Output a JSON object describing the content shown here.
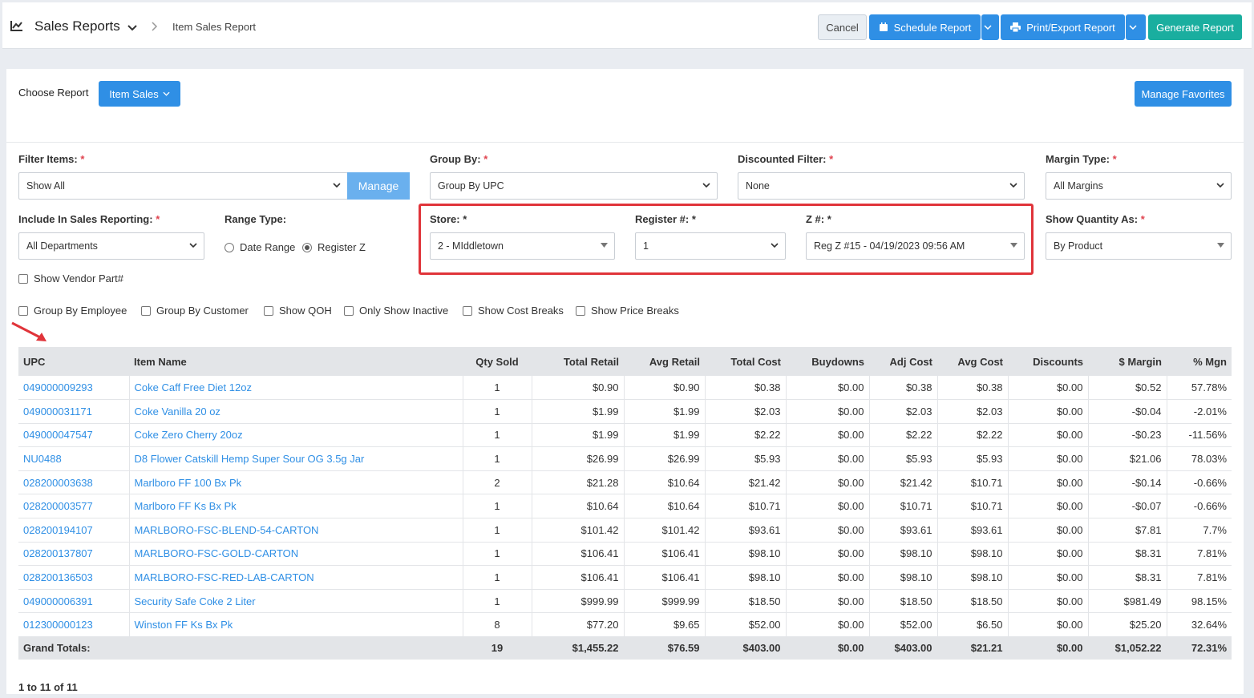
{
  "header": {
    "app_title": "Sales Reports",
    "breadcrumb": "Item Sales Report",
    "cancel": "Cancel",
    "schedule": "Schedule Report",
    "print_export": "Print/Export Report",
    "generate": "Generate Report"
  },
  "report": {
    "choose_label": "Choose Report",
    "selected": "Item Sales",
    "manage_favorites": "Manage Favorites"
  },
  "filters": {
    "filter_items": {
      "label": "Filter Items:",
      "value": "Show All",
      "manage": "Manage"
    },
    "group_by": {
      "label": "Group By:",
      "value": "Group By UPC"
    },
    "discounted": {
      "label": "Discounted Filter:",
      "value": "None"
    },
    "margin_type": {
      "label": "Margin Type:",
      "value": "All Margins"
    },
    "include": {
      "label": "Include In Sales Reporting:",
      "value": "All Departments"
    },
    "range_type": {
      "label": "Range Type:",
      "option_date": "Date Range",
      "option_register": "Register Z",
      "selected": "Register Z"
    },
    "store": {
      "label": "Store:",
      "value": "2 - MIddletown"
    },
    "register": {
      "label": "Register #:",
      "value": "1"
    },
    "z": {
      "label": "Z #:",
      "value": "Reg Z #15 - 04/19/2023 09:56 AM"
    },
    "show_qty": {
      "label": "Show Quantity As:",
      "value": "By Product"
    },
    "required_mark": "*",
    "show_vendor_part": "Show Vendor Part#",
    "checks": [
      "Group By Employee",
      "Group By Customer",
      "Show QOH",
      "Only Show Inactive",
      "Show Cost Breaks",
      "Show Price Breaks"
    ]
  },
  "table": {
    "columns": [
      "UPC",
      "Item Name",
      "Qty Sold",
      "Total Retail",
      "Avg Retail",
      "Total Cost",
      "Buydowns",
      "Adj Cost",
      "Avg Cost",
      "Discounts",
      "$ Margin",
      "% Mgn"
    ],
    "rows": [
      [
        "049000009293",
        "Coke Caff Free Diet 12oz",
        "1",
        "$0.90",
        "$0.90",
        "$0.38",
        "$0.00",
        "$0.38",
        "$0.38",
        "$0.00",
        "$0.52",
        "57.78%"
      ],
      [
        "049000031171",
        "Coke Vanilla 20 oz",
        "1",
        "$1.99",
        "$1.99",
        "$2.03",
        "$0.00",
        "$2.03",
        "$2.03",
        "$0.00",
        "-$0.04",
        "-2.01%"
      ],
      [
        "049000047547",
        "Coke Zero Cherry 20oz",
        "1",
        "$1.99",
        "$1.99",
        "$2.22",
        "$0.00",
        "$2.22",
        "$2.22",
        "$0.00",
        "-$0.23",
        "-11.56%"
      ],
      [
        "NU0488",
        "D8 Flower Catskill Hemp Super Sour OG 3.5g Jar",
        "1",
        "$26.99",
        "$26.99",
        "$5.93",
        "$0.00",
        "$5.93",
        "$5.93",
        "$0.00",
        "$21.06",
        "78.03%"
      ],
      [
        "028200003638",
        "Marlboro FF 100 Bx Pk",
        "2",
        "$21.28",
        "$10.64",
        "$21.42",
        "$0.00",
        "$21.42",
        "$10.71",
        "$0.00",
        "-$0.14",
        "-0.66%"
      ],
      [
        "028200003577",
        "Marlboro FF Ks Bx Pk",
        "1",
        "$10.64",
        "$10.64",
        "$10.71",
        "$0.00",
        "$10.71",
        "$10.71",
        "$0.00",
        "-$0.07",
        "-0.66%"
      ],
      [
        "028200194107",
        "MARLBORO-FSC-BLEND-54-CARTON",
        "1",
        "$101.42",
        "$101.42",
        "$93.61",
        "$0.00",
        "$93.61",
        "$93.61",
        "$0.00",
        "$7.81",
        "7.7%"
      ],
      [
        "028200137807",
        "MARLBORO-FSC-GOLD-CARTON",
        "1",
        "$106.41",
        "$106.41",
        "$98.10",
        "$0.00",
        "$98.10",
        "$98.10",
        "$0.00",
        "$8.31",
        "7.81%"
      ],
      [
        "028200136503",
        "MARLBORO-FSC-RED-LAB-CARTON",
        "1",
        "$106.41",
        "$106.41",
        "$98.10",
        "$0.00",
        "$98.10",
        "$98.10",
        "$0.00",
        "$8.31",
        "7.81%"
      ],
      [
        "049000006391",
        "Security Safe Coke 2 Liter",
        "1",
        "$999.99",
        "$999.99",
        "$18.50",
        "$0.00",
        "$18.50",
        "$18.50",
        "$0.00",
        "$981.49",
        "98.15%"
      ],
      [
        "012300000123",
        "Winston FF Ks Bx Pk",
        "8",
        "$77.20",
        "$9.65",
        "$52.00",
        "$0.00",
        "$52.00",
        "$6.50",
        "$0.00",
        "$25.20",
        "32.64%"
      ]
    ],
    "totals": [
      "Grand Totals:",
      "",
      "19",
      "$1,455.22",
      "$76.59",
      "$403.00",
      "$0.00",
      "$403.00",
      "$21.21",
      "$0.00",
      "$1,052.22",
      "72.31%"
    ]
  },
  "pager": "1 to 11 of 11",
  "colors": {
    "primary": "#2f8fe5",
    "success": "#1aae9f",
    "highlight": "#e0343a"
  }
}
